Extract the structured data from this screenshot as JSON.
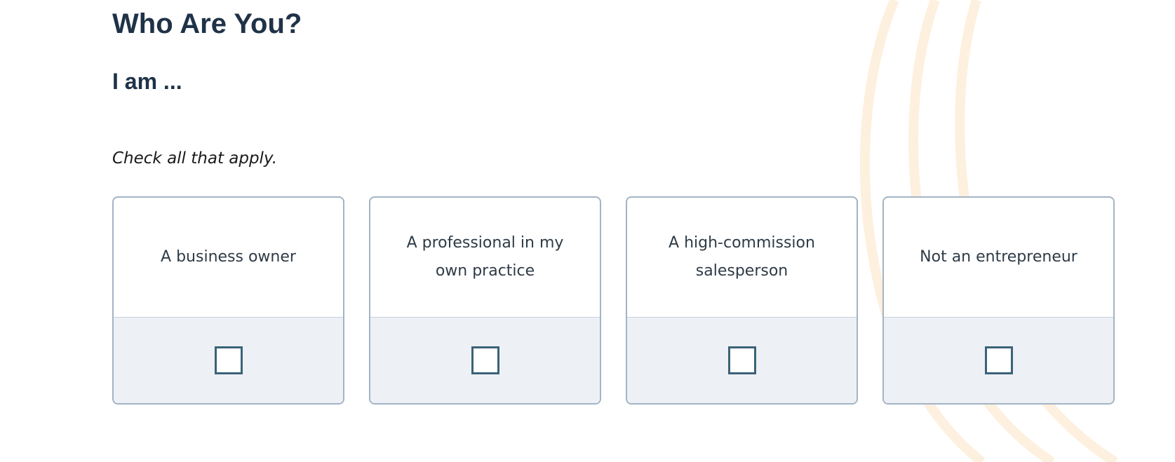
{
  "page": {
    "title": "Who Are You?",
    "subheading": "I am ...",
    "instruction": "Check all that apply."
  },
  "options": [
    {
      "label": "A business owner",
      "checked": false
    },
    {
      "label": "A professional in my own practice",
      "checked": false
    },
    {
      "label": "A high-commission salesperson",
      "checked": false
    },
    {
      "label": "Not an entrepreneur",
      "checked": false
    }
  ],
  "colors": {
    "heading": "#1f3247",
    "card_border": "#a3b4c6",
    "card_footer_bg": "#edf0f5",
    "checkbox_border": "#3a6378",
    "decor_arcs": "#fdf0df"
  }
}
